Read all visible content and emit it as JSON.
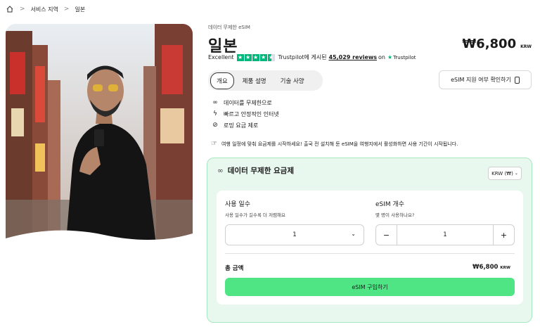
{
  "breadcrumb": {
    "home_icon": "home-icon",
    "items": [
      "서비스 지역",
      "일본"
    ],
    "separator": ">"
  },
  "product": {
    "tagline": "데이터 무제한 eSIM",
    "title": "일본",
    "price": "₩6,800",
    "currency_code": "KRW"
  },
  "trust": {
    "rating_word": "Excellent",
    "posted_on": "Trustpilot에 게시된",
    "reviews": "45,029 reviews",
    "on": "on",
    "brand": "Trustpilot",
    "stars": 4.5,
    "star_color": "#00b67a"
  },
  "tabs": [
    "개요",
    "제품 설명",
    "기술 사양"
  ],
  "check_button": "eSIM 지원 여부 확인하기",
  "features": [
    {
      "icon": "infinity-icon",
      "glyph": "∞",
      "text": "데이터를 무제한으로"
    },
    {
      "icon": "lightning-icon",
      "glyph": "ϟ",
      "text": "빠르고 안정적인 인터넷"
    },
    {
      "icon": "no-roaming-icon",
      "glyph": "⊘",
      "text": "로밍 요금 제로"
    }
  ],
  "notice": {
    "icon": "hand-icon",
    "glyph": "☞",
    "text": "여행 일정에 맞춰 요금제를 시작하세요! 출국 전 설치해 둔 eSIM을 여행지에서 활성화하면 사용 기간이 시작됩니다."
  },
  "plan": {
    "icon": "∞",
    "title": "데이터 무제한 요금제",
    "currency_select": "KRW (₩)",
    "days": {
      "title": "사용 일수",
      "subtitle": "사용 일수가 길수록 더 저렴해요",
      "value": "1"
    },
    "esim_count": {
      "title": "eSIM 개수",
      "subtitle": "몇 명이 사용하나요?",
      "value": "1",
      "minus": "−",
      "plus": "+"
    },
    "total_label": "총 금액",
    "total_value": "₩6,800",
    "total_currency": "KRW",
    "buy_button": "eSIM 구입하기",
    "accent_color": "#4fe585",
    "panel_color": "#e8f8ee"
  }
}
